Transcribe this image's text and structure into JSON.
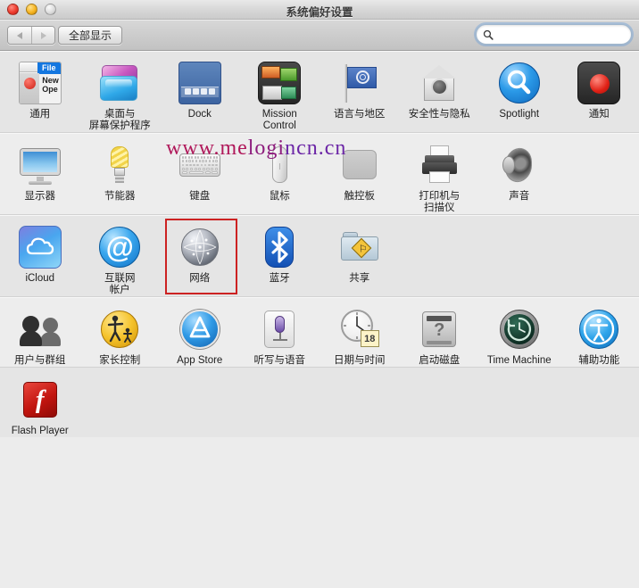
{
  "window": {
    "title": "系统偏好设置",
    "traffic_lights": [
      "close",
      "minimize",
      "zoom"
    ]
  },
  "toolbar": {
    "back_label": "◀",
    "forward_label": "▶",
    "show_all_label": "全部显示",
    "search": {
      "value": "",
      "placeholder": "",
      "icon": "search-icon"
    }
  },
  "watermark": {
    "part1": "www.me",
    "part2": "logi",
    "part3": "ncn.cn",
    "full_text": "www.melogincn.cn",
    "colors": [
      "#b0185a",
      "#8d1d7d",
      "#6b25a6"
    ]
  },
  "highlight": {
    "target": "网络",
    "color": "#cc2222"
  },
  "grid": {
    "columns": 8,
    "rows": [
      {
        "shade": "dark",
        "items": [
          {
            "label": "通用",
            "icon": "general-icon"
          },
          {
            "label": "桌面与\n屏幕保护程序",
            "icon": "desktop-screensaver-icon"
          },
          {
            "label": "Dock",
            "icon": "dock-icon"
          },
          {
            "label": "Mission\nControl",
            "icon": "mission-control-icon"
          },
          {
            "label": "语言与地区",
            "icon": "language-region-icon"
          },
          {
            "label": "安全性与隐私",
            "icon": "security-privacy-icon"
          },
          {
            "label": "Spotlight",
            "icon": "spotlight-icon"
          },
          {
            "label": "通知",
            "icon": "notifications-icon"
          }
        ]
      },
      {
        "shade": "light",
        "items": [
          {
            "label": "显示器",
            "icon": "displays-icon"
          },
          {
            "label": "节能器",
            "icon": "energy-saver-icon"
          },
          {
            "label": "键盘",
            "icon": "keyboard-icon"
          },
          {
            "label": "鼠标",
            "icon": "mouse-icon"
          },
          {
            "label": "触控板",
            "icon": "trackpad-icon"
          },
          {
            "label": "打印机与\n扫描仪",
            "icon": "printers-scanners-icon"
          },
          {
            "label": "声音",
            "icon": "sound-icon"
          },
          {
            "label": "",
            "icon": ""
          }
        ]
      },
      {
        "shade": "dark",
        "items": [
          {
            "label": "iCloud",
            "icon": "icloud-icon"
          },
          {
            "label": "互联网\n帐户",
            "icon": "internet-accounts-icon"
          },
          {
            "label": "网络",
            "icon": "network-icon",
            "marked": true
          },
          {
            "label": "蓝牙",
            "icon": "bluetooth-icon"
          },
          {
            "label": "共享",
            "icon": "sharing-icon"
          },
          {
            "label": "",
            "icon": ""
          },
          {
            "label": "",
            "icon": ""
          },
          {
            "label": "",
            "icon": ""
          }
        ]
      },
      {
        "shade": "light",
        "items": [
          {
            "label": "用户与群组",
            "icon": "users-groups-icon"
          },
          {
            "label": "家长控制",
            "icon": "parental-controls-icon"
          },
          {
            "label": "App Store",
            "icon": "app-store-icon"
          },
          {
            "label": "听写与语音",
            "icon": "dictation-speech-icon"
          },
          {
            "label": "日期与时间",
            "icon": "date-time-icon",
            "badge": "18"
          },
          {
            "label": "启动磁盘",
            "icon": "startup-disk-icon"
          },
          {
            "label": "Time Machine",
            "icon": "time-machine-icon"
          },
          {
            "label": "辅助功能",
            "icon": "accessibility-icon"
          }
        ]
      },
      {
        "shade": "dark",
        "items": [
          {
            "label": "Flash Player",
            "icon": "flash-player-icon"
          },
          {
            "label": "",
            "icon": ""
          },
          {
            "label": "",
            "icon": ""
          },
          {
            "label": "",
            "icon": ""
          },
          {
            "label": "",
            "icon": ""
          },
          {
            "label": "",
            "icon": ""
          },
          {
            "label": "",
            "icon": ""
          },
          {
            "label": "",
            "icon": ""
          }
        ]
      }
    ]
  }
}
